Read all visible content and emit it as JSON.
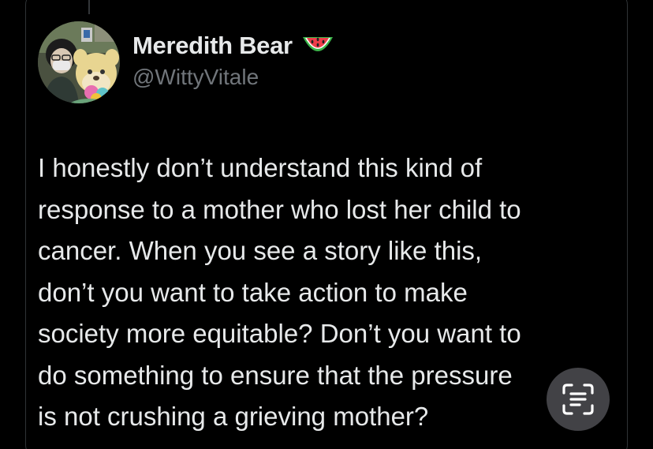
{
  "tweet": {
    "author_name": "Meredith Bear",
    "author_emoji": "watermelon-icon",
    "author_handle": "@WittyVitale",
    "text_lines": [
      "I honestly don’t understand this kind of",
      "response to a mother who lost her child to",
      "cancer. When you see a story like this,",
      "don’t you want to take action to make",
      "society more equitable? Don’t you want to",
      "do something to ensure that the pressure",
      "is not crushing a grieving mother?"
    ]
  },
  "overlay": {
    "icon": "live-text-icon"
  },
  "colors": {
    "background": "#000000",
    "primary_text": "#e7e9ea",
    "secondary_text": "#71767b",
    "border": "#2f3336"
  }
}
